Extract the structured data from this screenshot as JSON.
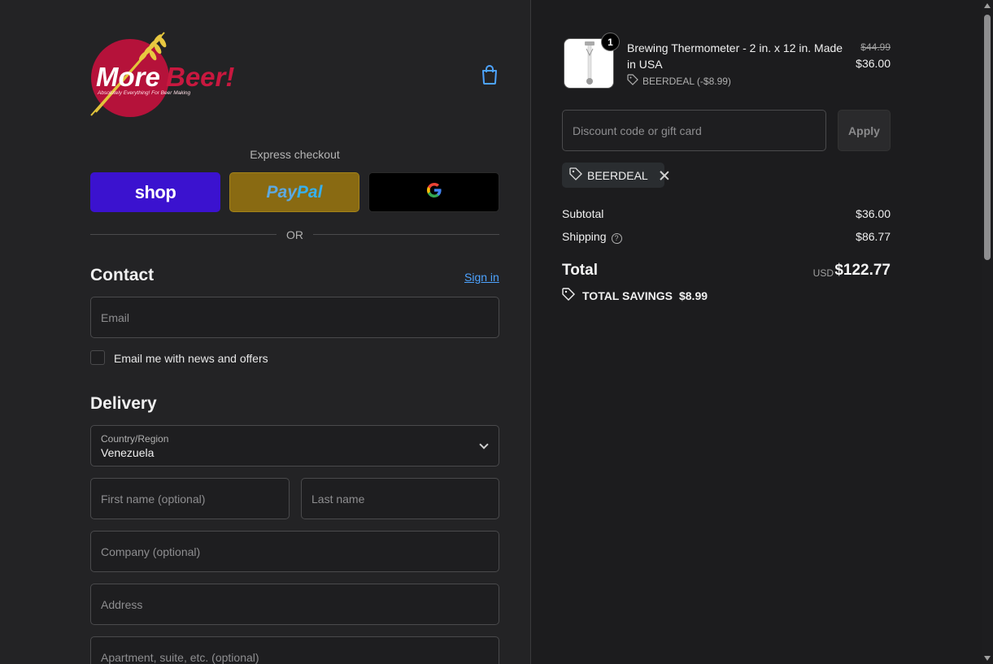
{
  "brand": {
    "logo_text": "More Beer!",
    "logo_tagline": "Absolutely Everything! For Beer Making"
  },
  "express": {
    "title": "Express checkout",
    "shop_label": "shop",
    "paypal_label_1": "Pay",
    "paypal_label_2": "Pal",
    "gpay_icon": "google-g-icon",
    "or_text": "OR"
  },
  "contact": {
    "title": "Contact",
    "sign_in": "Sign in",
    "email_placeholder": "Email",
    "newsletter_label": "Email me with news and offers"
  },
  "delivery": {
    "title": "Delivery",
    "country_label": "Country/Region",
    "country_value": "Venezuela",
    "first_name_placeholder": "First name (optional)",
    "last_name_placeholder": "Last name",
    "company_placeholder": "Company (optional)",
    "address_placeholder": "Address",
    "apartment_placeholder": "Apartment, suite, etc. (optional)"
  },
  "cart": {
    "item": {
      "quantity": "1",
      "name": "Brewing Thermometer - 2 in. x 12 in. Made in USA",
      "discount": "BEERDEAL (-$8.99)",
      "old_price": "$44.99",
      "price": "$36.00"
    },
    "discount_placeholder": "Discount code or gift card",
    "apply_label": "Apply",
    "applied_code": "BEERDEAL",
    "subtotal_label": "Subtotal",
    "subtotal_value": "$36.00",
    "shipping_label": "Shipping",
    "shipping_value": "$86.77",
    "total_label": "Total",
    "currency": "USD",
    "total_value": "$122.77",
    "savings_label": "TOTAL SAVINGS",
    "savings_value": "$8.99"
  },
  "colors": {
    "shop": "#3b12cf",
    "paypal": "#896a12",
    "link": "#4da3ff",
    "logo_red": "#b5123a"
  }
}
